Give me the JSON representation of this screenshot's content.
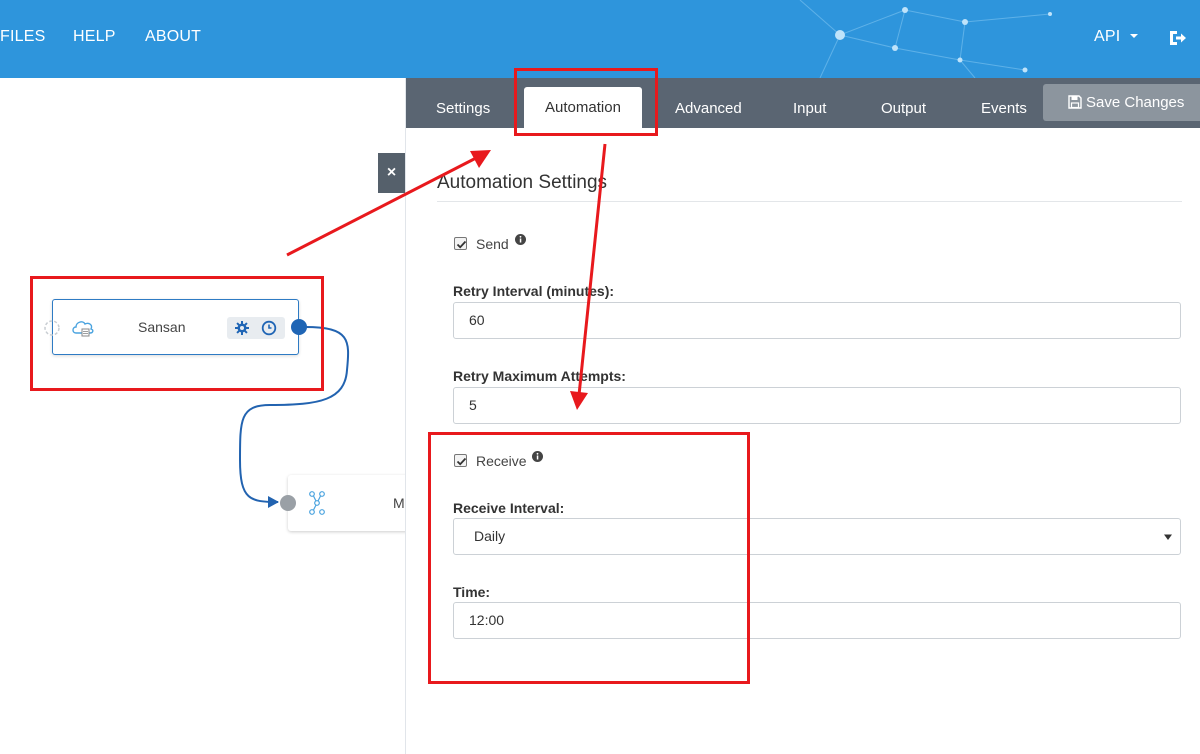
{
  "nav": {
    "items": [
      "FILES",
      "HELP",
      "ABOUT"
    ],
    "api_label": "API",
    "logout_icon": "sign-out-icon"
  },
  "canvas": {
    "close_label": "×",
    "nodes": [
      {
        "label": "Sansan",
        "icon": "cloud-icon"
      },
      {
        "label": "M",
        "icon": "flow-icon"
      }
    ]
  },
  "panel": {
    "tabs": [
      "Settings",
      "Automation",
      "Advanced",
      "Input",
      "Output",
      "Events"
    ],
    "active_tab": "Automation",
    "save_label": "Save Changes",
    "section_title": "Automation Settings",
    "send": {
      "label": "Send",
      "checked": true
    },
    "retry_interval": {
      "label": "Retry Interval (minutes):",
      "value": "60"
    },
    "retry_max": {
      "label": "Retry Maximum Attempts:",
      "value": "5"
    },
    "receive": {
      "label": "Receive",
      "checked": true
    },
    "receive_interval": {
      "label": "Receive Interval:",
      "value": "Daily"
    },
    "time": {
      "label": "Time:",
      "value": "12:00"
    }
  },
  "colors": {
    "topbar": "#2e95dc",
    "tabbar": "#5a6572",
    "annotation": "#e8191d",
    "node_accent": "#1f65b5"
  }
}
